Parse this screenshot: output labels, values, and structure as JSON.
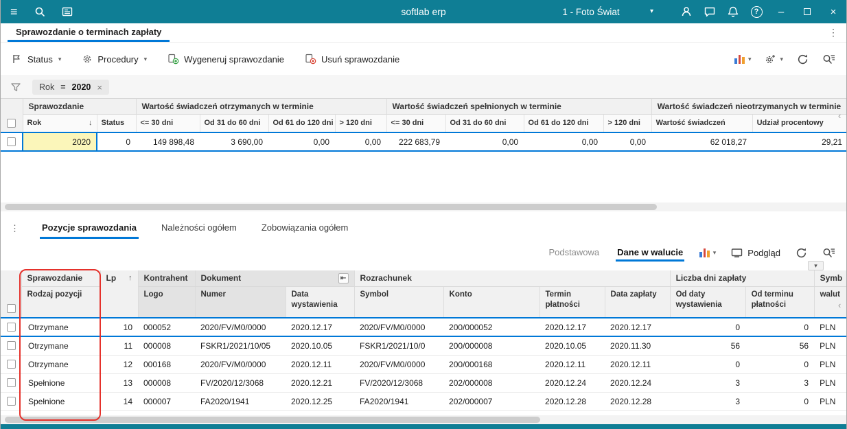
{
  "colors": {
    "accent": "#0078d7",
    "teal": "#0f7e95",
    "annotation": "#e5312b",
    "generate_green": "#2e9e3e",
    "remove_red": "#d84232"
  },
  "icons": {
    "menu": "≡",
    "ellipsis_v": "⋮",
    "dropdown": "▾",
    "sort_asc": "↑",
    "sort_desc": "↓",
    "minimize": "–",
    "close": "×",
    "chip_close": "×",
    "scroll_hint": "‹",
    "pin": "⇤",
    "help": "?"
  },
  "titlebar": {
    "app_title": "softlab erp",
    "company": "1 - Foto Świat"
  },
  "doc_tab": {
    "title": "Sprawozdanie o terminach zapłaty"
  },
  "toolbar": {
    "status": "Status",
    "procedures": "Procedury",
    "generate": "Wygeneruj sprawozdanie",
    "remove": "Usuń sprawozdanie"
  },
  "filter": {
    "field": "Rok",
    "operator": "=",
    "value": "2020"
  },
  "report_table": {
    "groups": [
      "Sprawozdanie",
      "Wartość świadczeń otrzymanych w terminie",
      "Wartość świadczeń spełnionych w terminie",
      "Wartość świadczeń nieotrzymanych w terminie"
    ],
    "cols": [
      "Rok",
      "Status",
      "<= 30 dni",
      "Od 31 do 60 dni",
      "Od 61 do 120 dni",
      "> 120 dni",
      "<= 30 dni",
      "Od 31 do 60 dni",
      "Od 61 do 120 dni",
      "> 120 dni",
      "Wartość świadczeń",
      "Udział procentowy"
    ],
    "row": [
      "2020",
      "0",
      "149 898,48",
      "3 690,00",
      "0,00",
      "0,00",
      "222 683,79",
      "0,00",
      "0,00",
      "0,00",
      "62 018,27",
      "29,21"
    ]
  },
  "section_tabs": {
    "items": [
      "Pozycje sprawozdania",
      "Należności ogółem",
      "Zobowiązania ogółem"
    ]
  },
  "view_toolbar": {
    "views": [
      "Podstawowa",
      "Dane w walucie"
    ],
    "preview": "Podgląd"
  },
  "positions_table": {
    "groups": {
      "sprawozdanie": "Sprawozdanie",
      "lp": "Lp",
      "kontrahent": "Kontrahent",
      "dokument": "Dokument",
      "rozrachunek": "Rozrachunek",
      "liczba_dni": "Liczba dni zapłaty",
      "symbol": "Symb"
    },
    "cols": {
      "rodzaj": "Rodzaj pozycji",
      "logo": "Logo",
      "numer": "Numer",
      "data_wystawienia": "Data wystawienia",
      "symbol": "Symbol",
      "konto": "Konto",
      "termin": "Termin płatności",
      "data_zaplaty": "Data zapłaty",
      "od_daty": "Od daty wystawienia",
      "od_terminu": "Od terminu płatności",
      "waluta": "walut"
    },
    "rows": [
      [
        "Otrzymane",
        "10",
        "000052",
        "2020/FV/M0/0000",
        "2020.12.17",
        "2020/FV/M0/0000",
        "200/000052",
        "2020.12.17",
        "2020.12.17",
        "0",
        "0",
        "PLN"
      ],
      [
        "Otrzymane",
        "11",
        "000008",
        "FSKR1/2021/10/05",
        "2020.10.05",
        "FSKR1/2021/10/0",
        "200/000008",
        "2020.10.05",
        "2020.11.30",
        "56",
        "56",
        "PLN"
      ],
      [
        "Otrzymane",
        "12",
        "000168",
        "2020/FV/M0/0000",
        "2020.12.11",
        "2020/FV/M0/0000",
        "200/000168",
        "2020.12.11",
        "2020.12.11",
        "0",
        "0",
        "PLN"
      ],
      [
        "Spełnione",
        "13",
        "000008",
        "FV/2020/12/3068",
        "2020.12.21",
        "FV/2020/12/3068",
        "202/000008",
        "2020.12.24",
        "2020.12.24",
        "3",
        "3",
        "PLN"
      ],
      [
        "Spełnione",
        "14",
        "000007",
        "FA2020/1941",
        "2020.12.25",
        "FA2020/1941",
        "202/000007",
        "2020.12.28",
        "2020.12.28",
        "3",
        "0",
        "PLN"
      ]
    ]
  }
}
